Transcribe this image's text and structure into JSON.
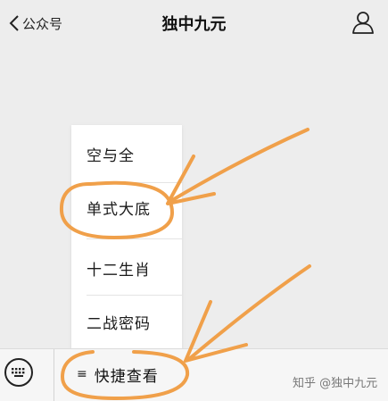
{
  "header": {
    "back_label": "公众号",
    "title": "独中九元",
    "back_icon": "chevron-left-icon",
    "profile_icon": "person-icon"
  },
  "menu": {
    "items": [
      {
        "label": "空与全"
      },
      {
        "label": "单式大底"
      },
      {
        "label": "十二生肖"
      },
      {
        "label": "二战密码"
      }
    ]
  },
  "bottom_bar": {
    "keyboard_icon": "keyboard-icon",
    "menu_glyph": "≡",
    "quick_view_label": "快捷查看"
  },
  "watermark": "知乎 @独中九元",
  "colors": {
    "annotation": "#f0a04a",
    "background": "#ededed"
  }
}
